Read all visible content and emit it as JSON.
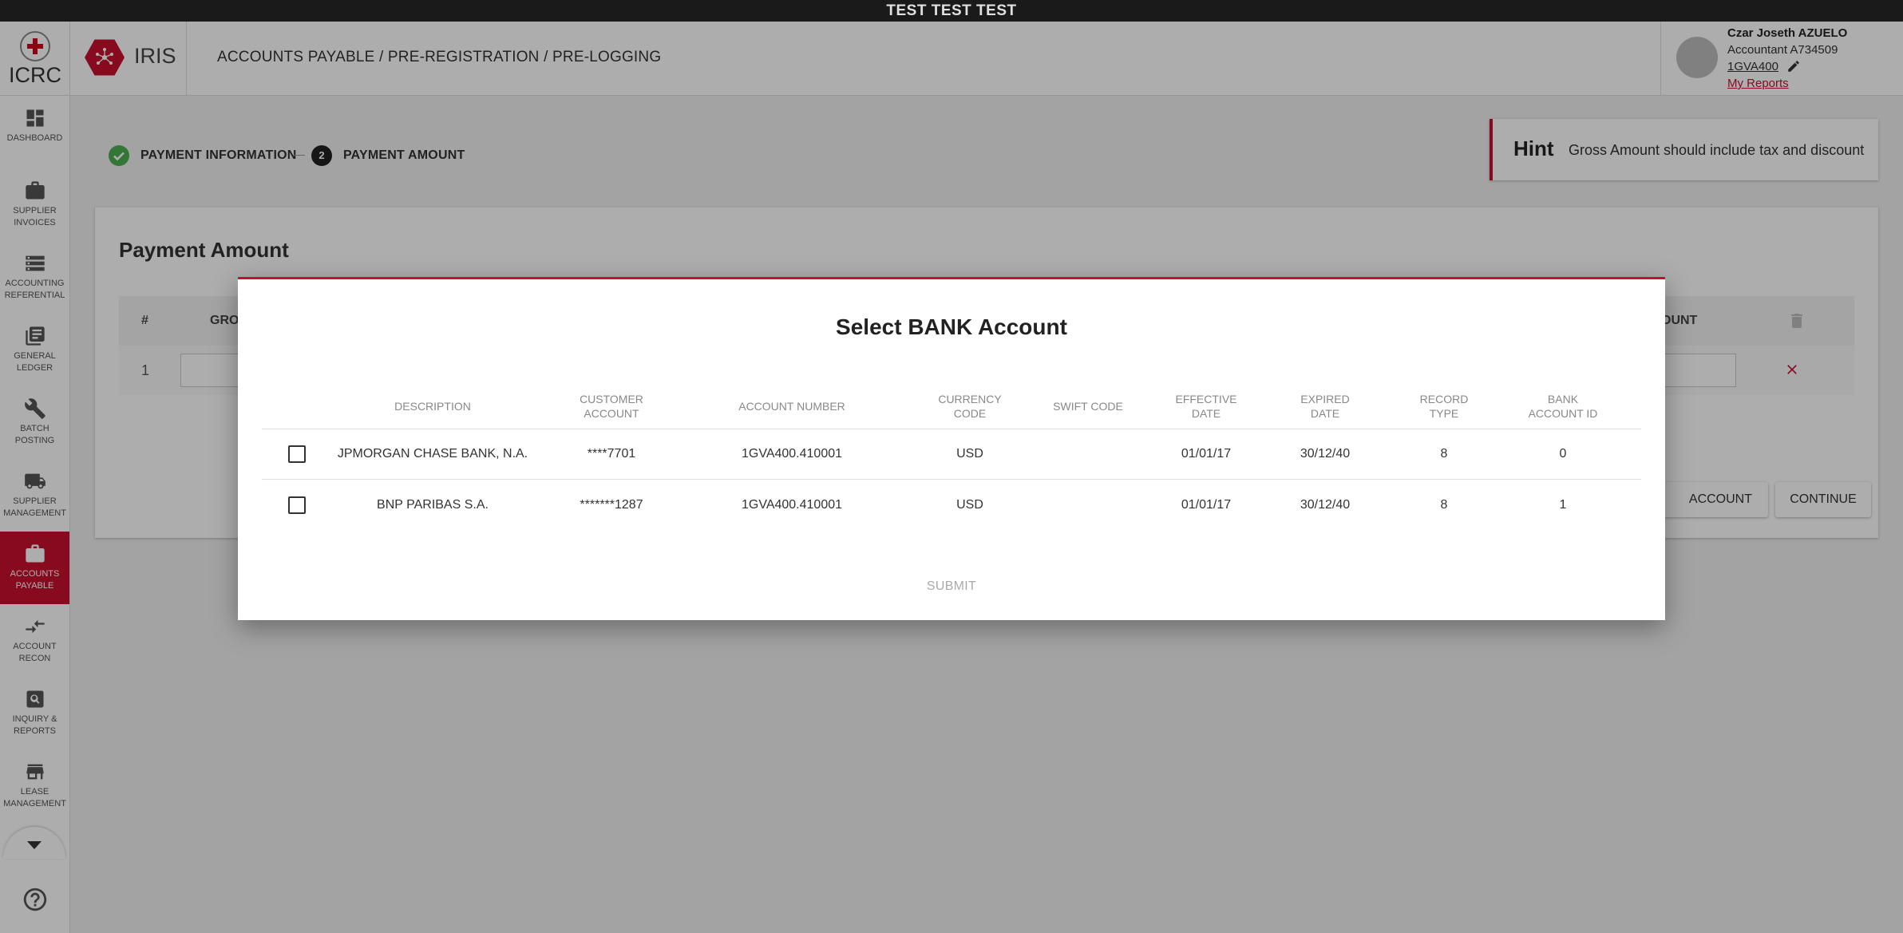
{
  "env_banner": "TEST TEST TEST",
  "header": {
    "org_name": "ICRC",
    "app_name": "IRIS",
    "breadcrumb": "ACCOUNTS PAYABLE / PRE-REGISTRATION / PRE-LOGGING",
    "user": {
      "name": "Czar Joseth AZUELO",
      "role": "Accountant A734509",
      "dept": "1GVA400",
      "reports_link": "My Reports"
    }
  },
  "sidebar": {
    "items": [
      {
        "label1": "DASHBOARD",
        "label2": "",
        "icon": "dashboard-icon"
      },
      {
        "label1": "SUPPLIER",
        "label2": "INVOICES",
        "icon": "briefcase-icon"
      },
      {
        "label1": "ACCOUNTING",
        "label2": "REFERENTIAL",
        "icon": "storage-icon"
      },
      {
        "label1": "GENERAL",
        "label2": "LEDGER",
        "icon": "library-books-icon"
      },
      {
        "label1": "BATCH",
        "label2": "POSTING",
        "icon": "wrench-icon"
      },
      {
        "label1": "SUPPLIER",
        "label2": "MANAGEMENT",
        "icon": "truck-icon"
      },
      {
        "label1": "ACCOUNTS",
        "label2": "PAYABLE",
        "icon": "briefcase-icon",
        "active": true
      },
      {
        "label1": "ACCOUNT",
        "label2": "RECON",
        "icon": "compare-arrows-icon"
      },
      {
        "label1": "INQUIRY &",
        "label2": "REPORTS",
        "icon": "search-box-icon"
      },
      {
        "label1": "LEASE",
        "label2": "MANAGEMENT",
        "icon": "store-icon"
      }
    ]
  },
  "stepper": {
    "step1": "PAYMENT INFORMATION",
    "step2_number": "2",
    "step2": "PAYMENT AMOUNT"
  },
  "hint": {
    "title": "Hint",
    "text": "Gross Amount should include tax and discount"
  },
  "payment": {
    "title": "Payment Amount",
    "col_number": "#",
    "col_gross": "GRO",
    "col_amount": "OUNT",
    "row_number": "1",
    "btn_account": "ACCOUNT",
    "btn_continue": "CONTINUE"
  },
  "modal": {
    "title": "Select BANK Account",
    "columns": {
      "description": "DESCRIPTION",
      "customer_account_1": "CUSTOMER",
      "customer_account_2": "ACCOUNT",
      "account_number": "ACCOUNT NUMBER",
      "currency_code_1": "CURRENCY",
      "currency_code_2": "CODE",
      "swift_code": "SWIFT CODE",
      "effective_date_1": "EFFECTIVE",
      "effective_date_2": "DATE",
      "expired_date_1": "EXPIRED",
      "expired_date_2": "DATE",
      "record_type_1": "RECORD",
      "record_type_2": "TYPE",
      "bank_account_id_1": "BANK",
      "bank_account_id_2": "ACCOUNT ID"
    },
    "rows": [
      {
        "description": "JPMORGAN CHASE BANK, N.A.",
        "customer_account": "****7701",
        "account_number": "1GVA400.410001",
        "currency_code": "USD",
        "swift_code": "",
        "effective_date": "01/01/17",
        "expired_date": "30/12/40",
        "record_type": "8",
        "bank_account_id": "0"
      },
      {
        "description": "BNP PARIBAS S.A.",
        "customer_account": "*******1287",
        "account_number": "1GVA400.410001",
        "currency_code": "USD",
        "swift_code": "",
        "effective_date": "01/01/17",
        "expired_date": "30/12/40",
        "record_type": "8",
        "bank_account_id": "1"
      }
    ],
    "submit_label": "SUBMIT"
  },
  "colors": {
    "brand_red": "#c8102e",
    "success_green": "#4caf50",
    "banner_bg": "#1a1a1a"
  }
}
